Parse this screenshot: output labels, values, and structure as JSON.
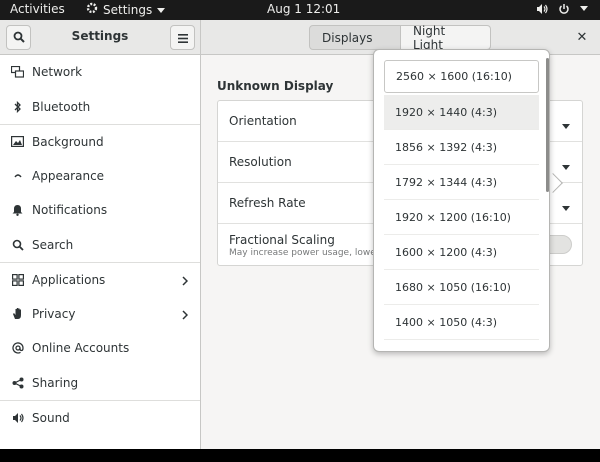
{
  "topbar": {
    "activities": "Activities",
    "app_name": "Settings",
    "clock": "Aug 1  12:01"
  },
  "header": {
    "title": "Settings",
    "tabs": [
      "Displays",
      "Night Light"
    ]
  },
  "sidebar": {
    "items": [
      {
        "label": "Network",
        "icon": "network-icon"
      },
      {
        "label": "Bluetooth",
        "icon": "bluetooth-icon"
      },
      {
        "label": "Background",
        "icon": "background-icon"
      },
      {
        "label": "Appearance",
        "icon": "appearance-icon"
      },
      {
        "label": "Notifications",
        "icon": "bell-icon"
      },
      {
        "label": "Search",
        "icon": "search-icon"
      },
      {
        "label": "Applications",
        "icon": "applications-icon"
      },
      {
        "label": "Privacy",
        "icon": "privacy-hand-icon"
      },
      {
        "label": "Online Accounts",
        "icon": "at-icon"
      },
      {
        "label": "Sharing",
        "icon": "share-icon"
      },
      {
        "label": "Sound",
        "icon": "speaker-icon"
      }
    ]
  },
  "display": {
    "name": "Unknown Display",
    "rows": {
      "orientation": "Orientation",
      "resolution": "Resolution",
      "refresh_rate": "Refresh Rate",
      "fractional_scaling": "Fractional Scaling",
      "fractional_scaling_sub": "May increase power usage, lower"
    }
  },
  "resolutions": [
    "2560 × 1600 (16:10)",
    "1920 × 1440 (4:3)",
    "1856 × 1392 (4:3)",
    "1792 × 1344 (4:3)",
    "1920 × 1200 (16:10)",
    "1600 × 1200 (4:3)",
    "1680 × 1050 (16:10)",
    "1400 × 1050 (4:3)"
  ],
  "colors": {
    "topbar": "#1a1a1a",
    "window_bg": "#f6f5f4",
    "text": "#2e3436"
  }
}
